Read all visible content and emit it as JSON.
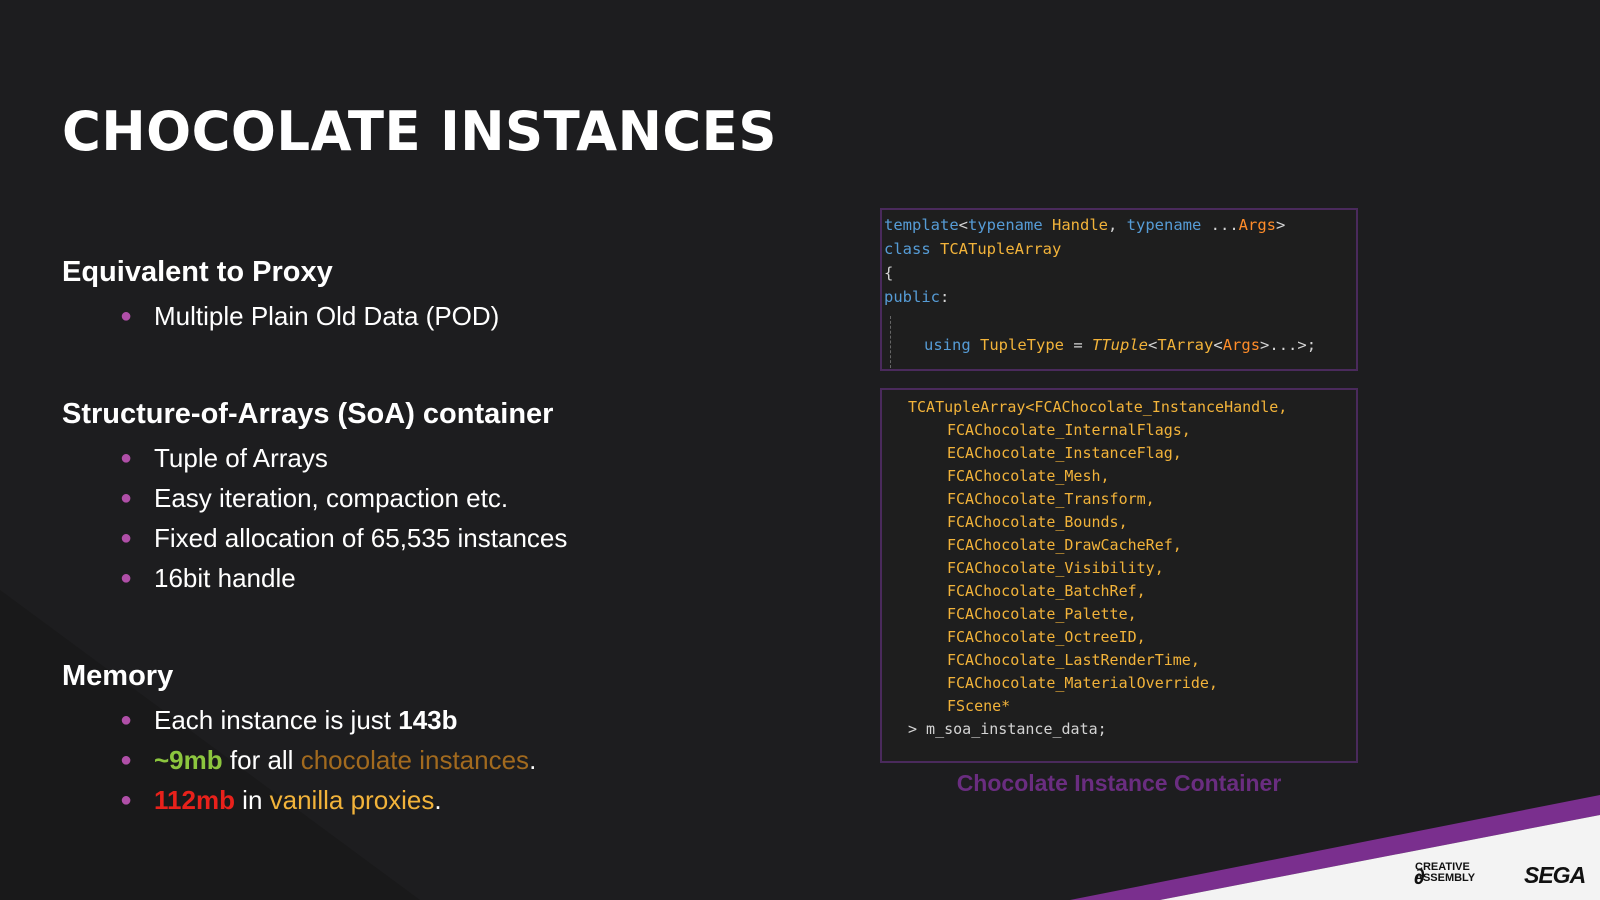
{
  "title": "CHOCOLATE INSTANCES",
  "sections": [
    {
      "heading": "Equivalent to Proxy",
      "bullets": [
        "Multiple Plain Old Data (POD)"
      ]
    },
    {
      "heading": "Structure-of-Arrays (SoA) container",
      "bullets": [
        "Tuple of Arrays",
        "Easy iteration, compaction etc.",
        "Fixed allocation of 65,535 instances",
        "16bit handle"
      ]
    },
    {
      "heading": "Memory",
      "bullets": [
        {
          "pre": "Each instance is just ",
          "bold": "143b"
        },
        {
          "value": "~9mb",
          "mid": " for all ",
          "highlight": "chocolate instances",
          "post": "."
        },
        {
          "value": "112mb",
          "mid": " in ",
          "highlight": "vanilla proxies",
          "post": "."
        }
      ]
    }
  ],
  "code1": {
    "template": "template",
    "lt": "<",
    "typename1": "typename",
    "handle": "Handle",
    "comma": ", ",
    "typename2": "typename",
    "dots": " ...",
    "args": "Args",
    "gt": ">",
    "class_kw": "class",
    "class_name": "TCATupleArray",
    "brace": "{",
    "public": "public",
    "colon": ":",
    "using": "using",
    "tuple_type": "TupleType",
    "eq": " = ",
    "ttuple": "TTuple",
    "tarray": "TArray",
    "args2": "Args",
    "tail": ">...>;"
  },
  "code2": {
    "first_line": "TCATupleArray<FCAChocolate_InstanceHandle,",
    "lines": [
      "FCAChocolate_InternalFlags,",
      "ECAChocolate_InstanceFlag,",
      "FCAChocolate_Mesh,",
      "FCAChocolate_Transform,",
      "FCAChocolate_Bounds,",
      "FCAChocolate_DrawCacheRef,",
      "FCAChocolate_Visibility,",
      "FCAChocolate_BatchRef,",
      "FCAChocolate_Palette,",
      "FCAChocolate_OctreeID,",
      "FCAChocolate_LastRenderTime,",
      "FCAChocolate_MaterialOverride,",
      "FScene*"
    ],
    "last_line": "> m_soa_instance_data;"
  },
  "caption": "Chocolate Instance Container",
  "logos": {
    "creative_assembly": [
      "CREATIVE",
      "ASSEMBLY"
    ],
    "sega": "SEGA"
  },
  "colors": {
    "background": "#1d1d1f",
    "bullet": "#b04fa8",
    "green": "#8cc63e",
    "red": "#e8211b",
    "gold": "#f2b33a",
    "brown": "#a26a1e",
    "caption": "#6a2d80",
    "purple_stripe": "#7a2f8e"
  }
}
